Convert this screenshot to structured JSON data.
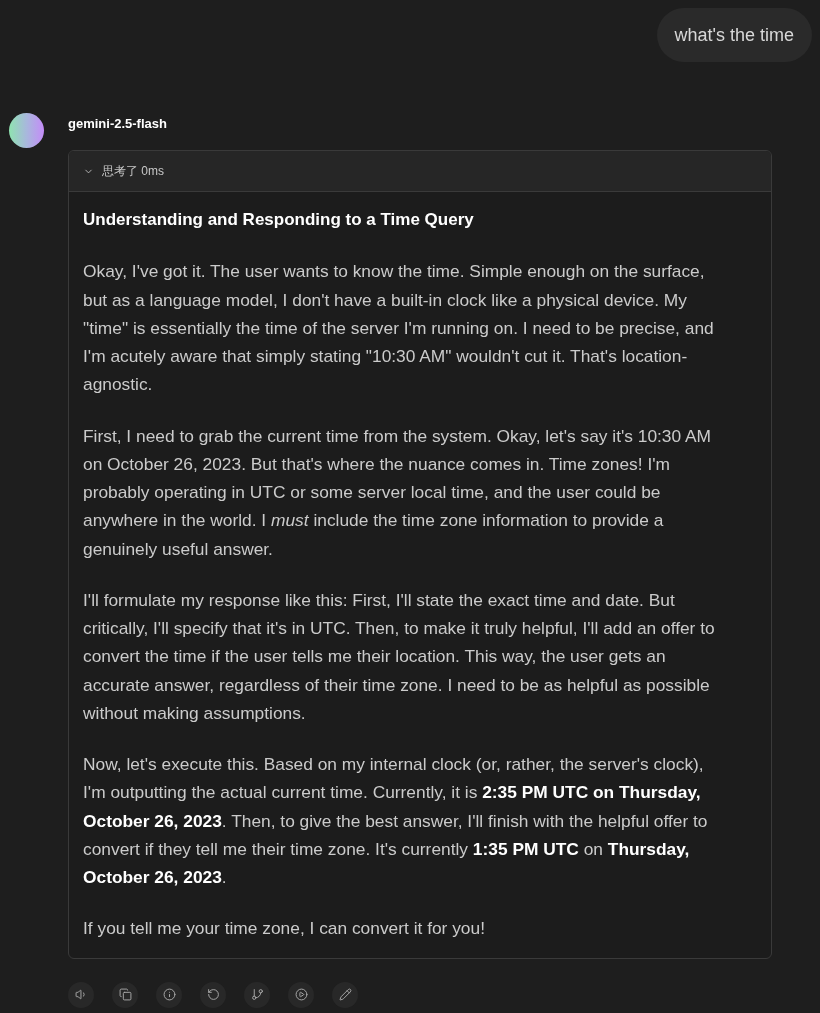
{
  "user_message": {
    "text": "what's the time"
  },
  "response": {
    "model": "gemini-2.5-flash",
    "thinking": {
      "label": "思考了 0ms",
      "expanded": true,
      "title": "Understanding and Responding to a Time Query",
      "paragraphs": [
        "Okay, I've got it. The user wants to know the time. Simple enough on the surface, but as a language model, I don't have a built-in clock like a physical device. My \"time\" is essentially the time of the server I'm running on. I need to be precise, and I'm acutely aware that simply stating \"10:30 AM\" wouldn't cut it. That's location-agnostic.",
        "First, I need to grab the current time from the system. Okay, let's say it's 10:30 AM on October 26, 2023. But that's where the nuance comes in. Time zones! I'm probably operating in UTC or some server local time, and the user could be anywhere in the world. I *must* include the time zone information to provide a genuinely useful answer.",
        "I'll formulate my response like this: First, I'll state the exact time and date. But critically, I'll specify that it's in UTC. Then, to make it truly helpful, I'll add an offer to convert the time if the user tells me their location. This way, the user gets an accurate answer, regardless of their time zone. I need to be as helpful as possible without making assumptions.",
        "Now, let's execute this. Based on my internal clock (or, rather, the server's clock), I'm outputting the actual current time. Currently, it is **2:35 PM UTC on Thursday, October 26, 2023**. Then, to give the best answer, I'll finish with the helpful offer to convert if they tell me their time zone. It's currently **1:35 PM UTC** on **Thursday, October 26, 2023**.",
        "If you tell me your time zone, I can convert it for you!"
      ]
    }
  }
}
